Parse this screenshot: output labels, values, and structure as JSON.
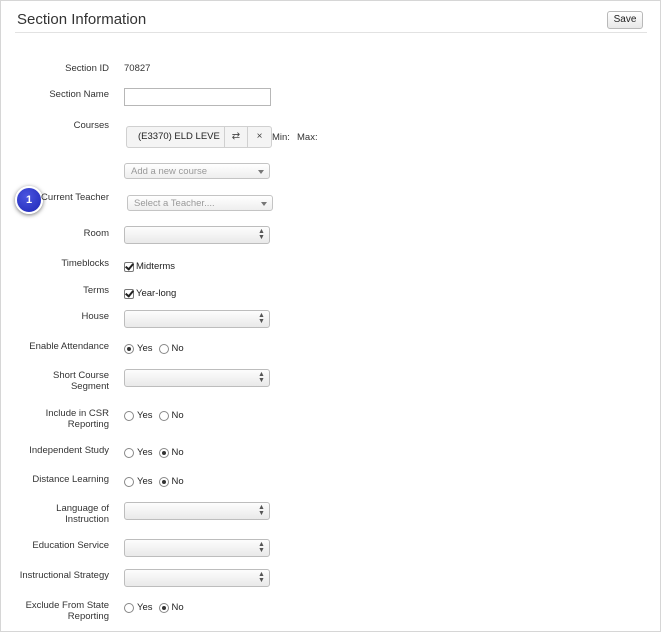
{
  "header": {
    "title": "Section Information",
    "save_label": "Save"
  },
  "fields": {
    "section_id": {
      "label": "Section ID",
      "value": "70827"
    },
    "section_name": {
      "label": "Section Name",
      "value": ""
    },
    "courses": {
      "label": "Courses",
      "chip": "(E3370) ELD LEVE",
      "swap_glyph": "⇄",
      "remove_glyph": "×",
      "min_label": "Min:",
      "max_label": "Max:",
      "add_placeholder": "Add a new course"
    },
    "current_teacher": {
      "label": "Current Teacher",
      "placeholder": "Select a Teacher...."
    },
    "room": {
      "label": "Room"
    },
    "timeblocks": {
      "label": "Timeblocks",
      "option": "Midterms"
    },
    "terms": {
      "label": "Terms",
      "option": "Year-long"
    },
    "house": {
      "label": "House"
    },
    "enable_attendance": {
      "label": "Enable Attendance",
      "yes": "Yes",
      "no": "No",
      "selected": "yes"
    },
    "short_course_segment": {
      "label_line1": "Short Course",
      "label_line2": "Segment"
    },
    "include_csr": {
      "label_line1": "Include in CSR",
      "label_line2": "Reporting",
      "yes": "Yes",
      "no": "No",
      "selected": "none"
    },
    "independent_study": {
      "label": "Independent Study",
      "yes": "Yes",
      "no": "No",
      "selected": "no"
    },
    "distance_learning": {
      "label": "Distance Learning",
      "yes": "Yes",
      "no": "No",
      "selected": "no"
    },
    "language_of_instruction": {
      "label_line1": "Language of",
      "label_line2": "Instruction"
    },
    "education_service": {
      "label": "Education Service"
    },
    "instructional_strategy": {
      "label": "Instructional Strategy"
    },
    "exclude_state_reporting": {
      "label_line1": "Exclude From State",
      "label_line2": "Reporting",
      "yes": "Yes",
      "no": "No",
      "selected": "no"
    }
  },
  "annotation": {
    "step_number": "1"
  },
  "colors": {
    "badge": "#2631c4",
    "border": "#d6d6d6"
  }
}
